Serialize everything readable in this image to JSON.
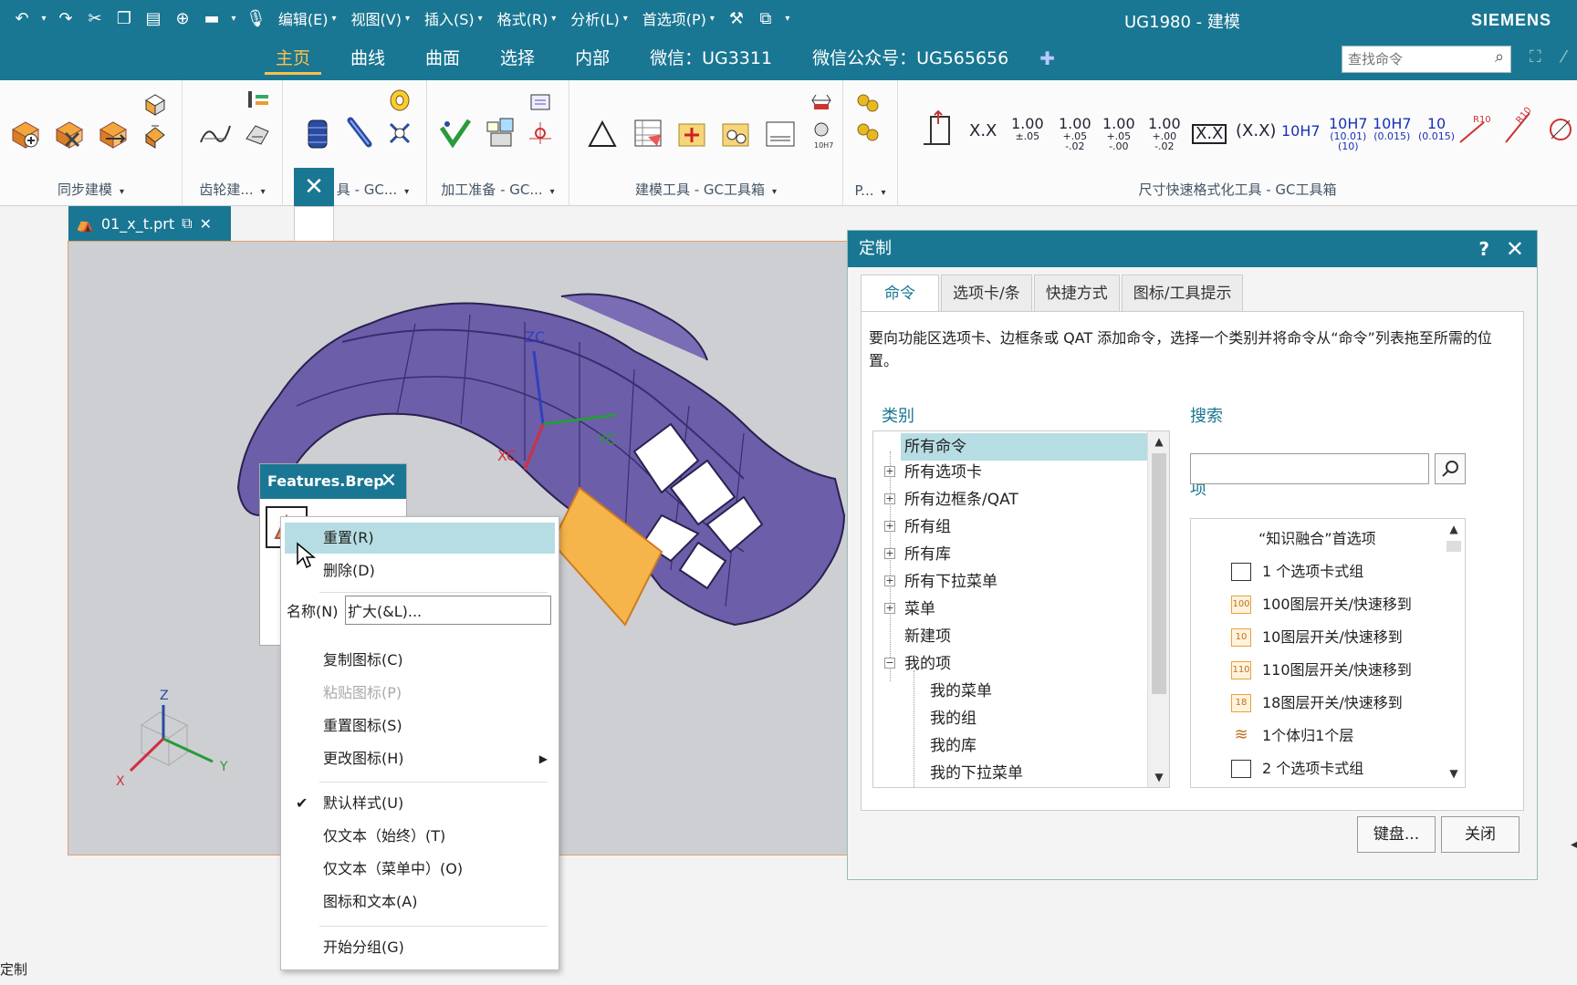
{
  "titlebar": {
    "title": "UG1980 - 建模",
    "brand": "SIEMENS",
    "menus": [
      "编辑(E)",
      "视图(V)",
      "插入(S)",
      "格式(R)",
      "分析(L)",
      "首选项(P)"
    ]
  },
  "ribbon_tabs": [
    "主页",
    "曲线",
    "曲面",
    "选择",
    "内部",
    "微信：UG3311",
    "微信公众号：UG565656"
  ],
  "command_search_placeholder": "查找命令",
  "ribbon_groups": [
    "同步建模",
    "齿轮建...",
    "具 - GC...",
    "加工准备 - GC...",
    "建模工具 - GC工具箱",
    "P...",
    "尺寸快速格式化工具 - GC工具箱"
  ],
  "dim_buttons": [
    "X.X",
    "1.00",
    "±.05",
    "1.00",
    "+.05",
    "-.02",
    "1.00",
    "+.05",
    "-.00",
    "1.00",
    "+.00",
    "-.02",
    "X.X",
    "(X.X)",
    "10H7",
    "10H7",
    "(10.01)",
    "(10)",
    "10H7",
    "(0.015)",
    "10",
    "(0.015)"
  ],
  "document_tab": "01_x_t.prt",
  "features_popup": {
    "title": "Features.Brep"
  },
  "context_menu": {
    "reset": "重置(R)",
    "delete": "删除(D)",
    "name_label": "名称(N)",
    "name_value": "扩大(&L)...",
    "copy_icon": "复制图标(C)",
    "paste_icon": "粘贴图标(P)",
    "reset_icon": "重置图标(S)",
    "change_icon": "更改图标(H)",
    "default_style": "默认样式(U)",
    "text_only_always": "仅文本（始终）(T)",
    "text_only_menu": "仅文本（菜单中）(O)",
    "icon_and_text": "图标和文本(A)",
    "begin_group": "开始分组(G)"
  },
  "dialog": {
    "title": "定制",
    "help": "?",
    "tabs": [
      "命令",
      "选项卡/条",
      "快捷方式",
      "图标/工具提示"
    ],
    "description": "要向功能区选项卡、边框条或 QAT 添加命令，选择一个类别并将命令从“命令”列表拖至所需的位置。",
    "category_label": "类别",
    "search_label": "搜索",
    "items_label": "项",
    "categories": [
      "所有命令",
      "所有选项卡",
      "所有边框条/QAT",
      "所有组",
      "所有库",
      "所有下拉菜单",
      "菜单",
      "新建项",
      "我的项",
      "我的菜单",
      "我的组",
      "我的库",
      "我的下拉菜单"
    ],
    "items": [
      {
        "label": "“知识融合”首选项",
        "icon": ""
      },
      {
        "label": "1 个选项卡式组",
        "icon": "checkbox-icon"
      },
      {
        "label": "100图层开关/快速移到",
        "icon": "100"
      },
      {
        "label": "10图层开关/快速移到",
        "icon": "10"
      },
      {
        "label": "110图层开关/快速移到",
        "icon": "110"
      },
      {
        "label": "18图层开关/快速移到",
        "icon": "18"
      },
      {
        "label": "1个体归1个层",
        "icon": "layers-icon"
      },
      {
        "label": "2 个选项卡式组",
        "icon": "checkbox-icon"
      }
    ],
    "keyboard_button": "键盘...",
    "close_button": "关闭"
  },
  "axes": {
    "x": "X",
    "y": "Y",
    "z": "Z",
    "zc": "ZC",
    "yc": "YC",
    "xc": "XC"
  },
  "status_text": "定制",
  "colors": {
    "teal": "#1a7793",
    "highlight": "#b6dde3",
    "active_tab": "#ffc04a",
    "model": "#6c5ea8"
  }
}
